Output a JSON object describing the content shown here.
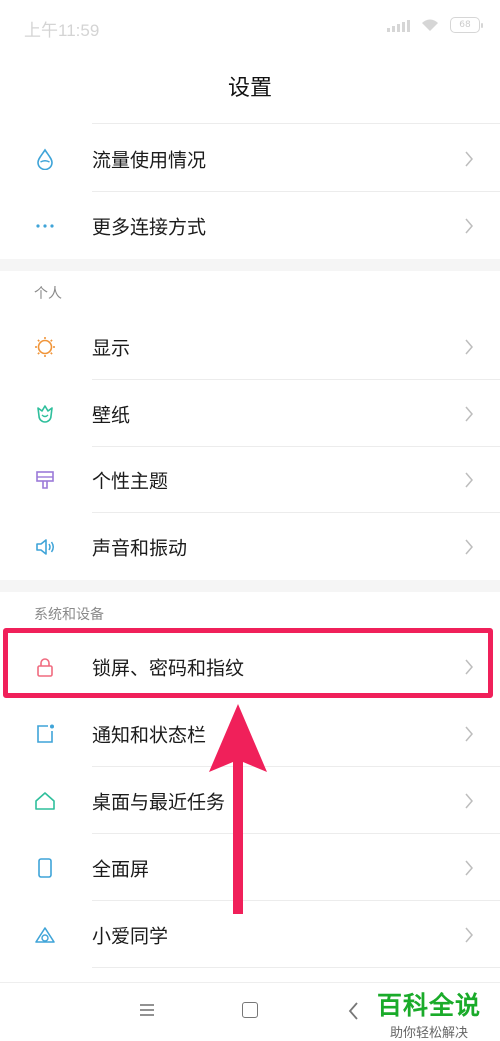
{
  "status": {
    "time": "上午11:59",
    "battery": "68"
  },
  "header": {
    "title": "设置"
  },
  "sections": {
    "top": [
      {
        "label": "流量使用情况",
        "icon": "water-drop-icon"
      },
      {
        "label": "更多连接方式",
        "icon": "more-dots-icon"
      }
    ],
    "personal": {
      "header": "个人",
      "items": [
        {
          "label": "显示",
          "icon": "sun-icon"
        },
        {
          "label": "壁纸",
          "icon": "tulip-icon"
        },
        {
          "label": "个性主题",
          "icon": "paintbrush-icon"
        },
        {
          "label": "声音和振动",
          "icon": "speaker-icon"
        }
      ]
    },
    "system": {
      "header": "系统和设备",
      "items": [
        {
          "label": "锁屏、密码和指纹",
          "icon": "lock-icon"
        },
        {
          "label": "通知和状态栏",
          "icon": "notification-icon"
        },
        {
          "label": "桌面与最近任务",
          "icon": "home-icon"
        },
        {
          "label": "全面屏",
          "icon": "phone-icon"
        },
        {
          "label": "小爱同学",
          "icon": "xiaoai-icon"
        }
      ]
    }
  },
  "watermark": {
    "title": "百科全说",
    "subtitle": "助你轻松解决"
  },
  "colors": {
    "highlight": "#f0205a",
    "watermark": "#1aab2a"
  }
}
